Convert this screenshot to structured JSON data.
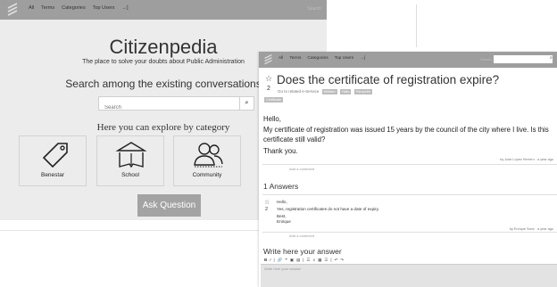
{
  "background_page": {
    "nav": {
      "items": [
        "All",
        "Terms",
        "Categories",
        "Top Users",
        "→]"
      ],
      "right_text": "Search"
    },
    "hero": {
      "title": "Citizenpedia",
      "subtitle": "The place to solve your doubts about Public Administration",
      "search_heading": "Search among the existing conversations",
      "search_placeholder": "Search",
      "categories_heading": "Here you can explore by category"
    },
    "categories": [
      {
        "label": "Benestar",
        "icon": "tag-icon"
      },
      {
        "label": "School",
        "icon": "school-icon"
      },
      {
        "label": "Community",
        "icon": "community-icon"
      }
    ],
    "ask_button": "Ask Question"
  },
  "question_page": {
    "nav": {
      "items": [
        "All",
        "Terms",
        "Categories",
        "Top Users",
        "→]"
      ],
      "search_placeholder": "Search"
    },
    "question": {
      "votes": "2",
      "title": "Does the certificate of registration expire?",
      "meta": "Go to related e-Service",
      "tags": [
        "Welfare",
        "Hallo",
        "Pamphlet"
      ],
      "extra_tag": "Certificate",
      "body": [
        "Hello,",
        "My certificate of registration was issued 15 years by the council of the city where I live. Is this certificate still valid?",
        "Thank you."
      ],
      "byline": "by Jose Lopez Herrero · a year ago",
      "add_comment": "Add a comment"
    },
    "answers_heading": "1 Answers",
    "answer": {
      "votes": "2",
      "lines": [
        "Hello,",
        "Yes, registration certificates do not have a date of expiry.",
        "Best,",
        "Enrique"
      ],
      "byline": "by Enrique Sanz · a year ago",
      "add_comment": "Add a comment"
    },
    "write_heading": "Write here your answer",
    "toolbar": [
      "B",
      "I",
      "|",
      "🔗",
      "❝",
      "▣",
      "▤",
      "|",
      "☰",
      "≡",
      "▦",
      "☰",
      "|",
      "↶",
      "↷"
    ],
    "editor_placeholder": "Write here your answer"
  }
}
